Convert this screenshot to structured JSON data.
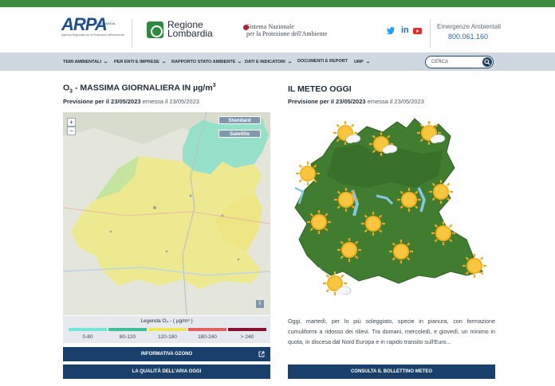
{
  "header": {
    "arpa_logo_text": "ARPA",
    "arpa_region": "LOMBARDIA",
    "arpa_subtitle": "Agenzia Regionale per la Protezione dell'Ambiente",
    "rl_line1": "Regione",
    "rl_line2": "Lombardia",
    "snpa_line1": "Sistema Nazionale",
    "snpa_line2": "per la Protezione dell'Ambiente",
    "social": [
      "twitter-icon",
      "linkedin-icon",
      "youtube-icon"
    ],
    "emergency_label": "Emergenze Ambientali",
    "emergency_number": "800.061.160"
  },
  "nav": {
    "items": [
      "TEMI AMBIENTALI",
      "PER ENTI E IMPRESE",
      "RAPPORTO STATO AMBIENTE",
      "DATI E INDICATORI",
      "DOCUMENTI E REPORT",
      "URP"
    ],
    "search_placeholder": "CERCA"
  },
  "ozone": {
    "title_prefix": "O",
    "title_sub": "3",
    "title_main": " - MASSIMA GIORNALIERA IN µg/m",
    "title_sup": "3",
    "forecast_label": "Previsione per il 23/05/2023",
    "issued": " emessa il 23/05/2023",
    "btn_standard": "Standard",
    "btn_satellite": "Satellite",
    "zoom_in": "+",
    "zoom_out": "−",
    "info": "i",
    "legend_title": "Legenda O₃ - ( µg/m³ )",
    "legend": [
      {
        "label": "0-80",
        "color": "#73e6dc"
      },
      {
        "label": "80-120",
        "color": "#3dbf9a"
      },
      {
        "label": "120-180",
        "color": "#f0e65a"
      },
      {
        "label": "180-240",
        "color": "#e06060"
      },
      {
        "label": "> 240",
        "color": "#8a1030"
      }
    ],
    "btn_info": "INFORMATIVA OZONO",
    "btn_quality": "LA QUALITÀ DELL'ARIA OGGI"
  },
  "meteo": {
    "title": "IL METEO OGGI",
    "forecast_label": "Previsione per il  23/05/2023",
    "issued": " emessa il 23/05/2023",
    "text": "Oggi, martedì, per lo più soleggiato, specie in pianura, con formazione cumuliformi a ridosso dei rilievi. Tra domani, mercoledì, e giovedì, un minimo in quota, in discesa dal Nord Europa e in rapido transito sull'Euro...",
    "btn_bulletin": "CONSULTA IL BOLLETTINO METEO"
  },
  "colors": {
    "accent_green": "#3d8c3d",
    "nav_bg": "#cfd8e0",
    "button_dark": "#18406b",
    "meteo_map": "#3f7a2f"
  }
}
